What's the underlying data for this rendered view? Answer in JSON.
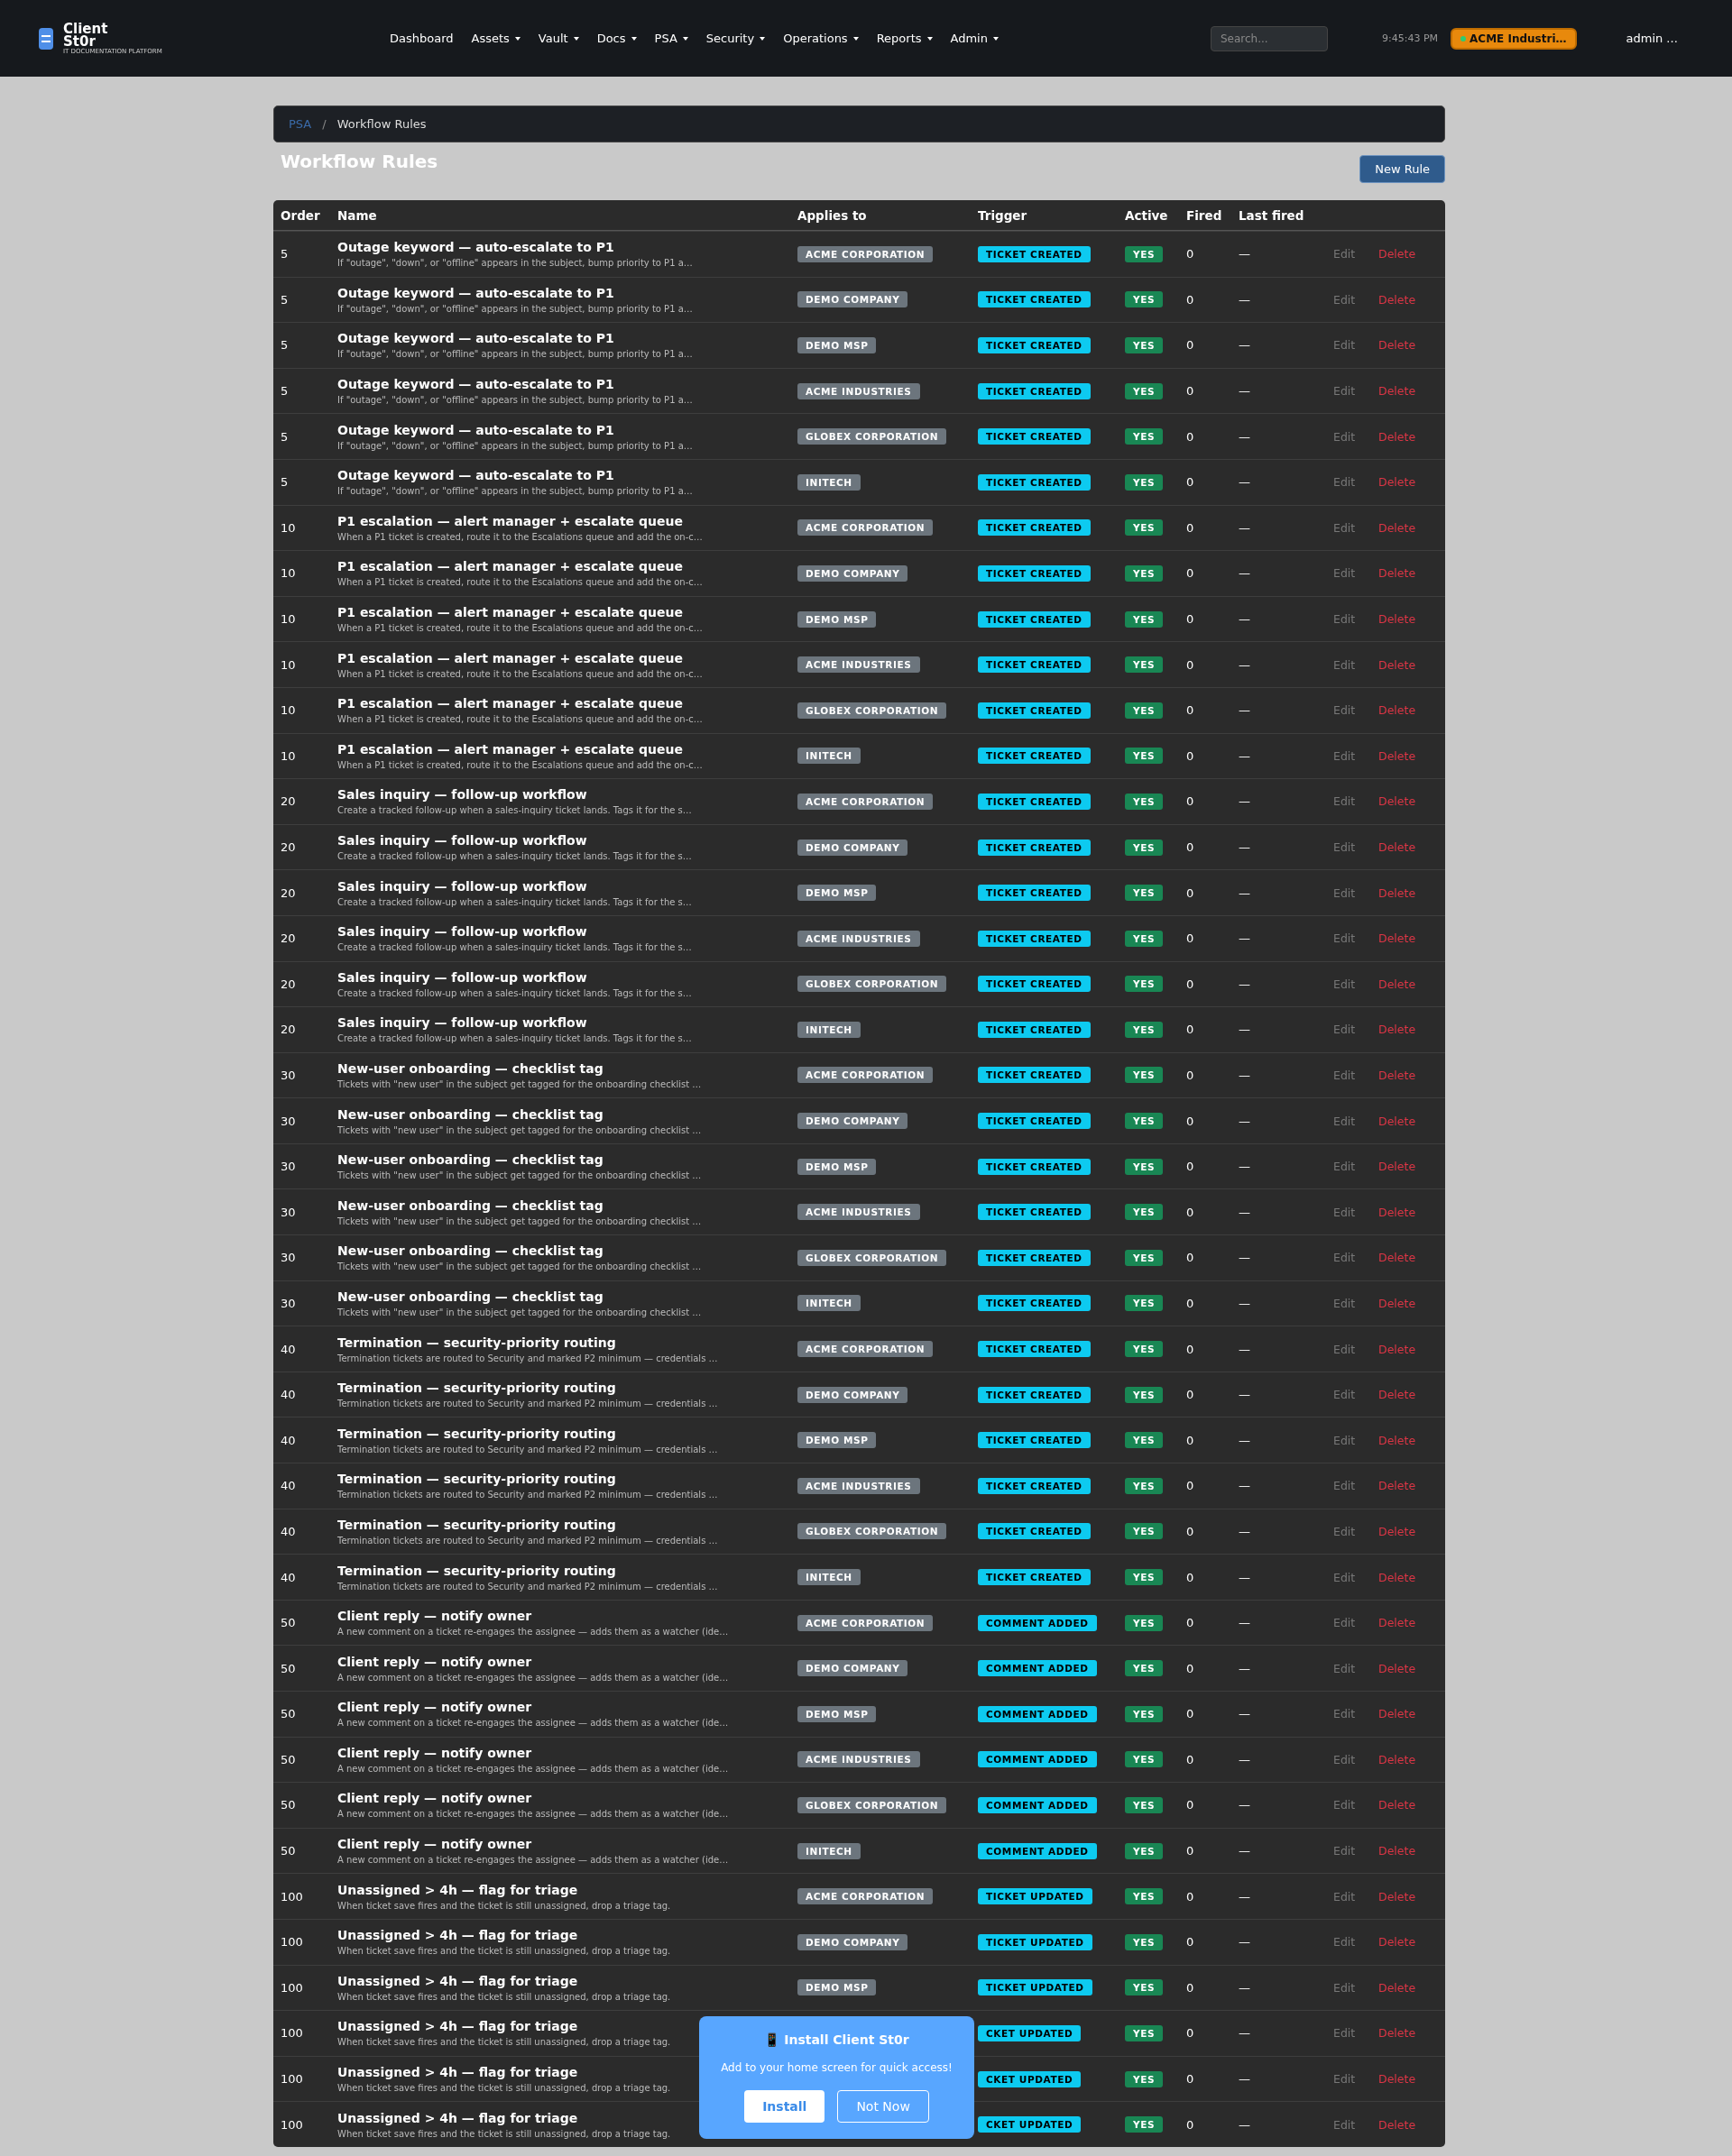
{
  "navbar": {
    "logo_title": "Client St0r",
    "logo_subtitle": "IT DOCUMENTATION PLATFORM",
    "menu": [
      {
        "label": "Dashboard",
        "dropdown": false
      },
      {
        "label": "Assets",
        "dropdown": true
      },
      {
        "label": "Vault",
        "dropdown": true
      },
      {
        "label": "Docs",
        "dropdown": true
      },
      {
        "label": "PSA",
        "dropdown": true
      },
      {
        "label": "Security",
        "dropdown": true
      },
      {
        "label": "Operations",
        "dropdown": true
      },
      {
        "label": "Reports",
        "dropdown": true
      },
      {
        "label": "Admin",
        "dropdown": true
      }
    ],
    "search": {
      "placeholder": "Search..."
    },
    "time": "9:45:43 PM",
    "org": "ACME Industri…",
    "user": "admin ..."
  },
  "breadcrumb_separator": "/",
  "breadcrumb": [
    {
      "label": "PSA",
      "link": true
    },
    {
      "label": "Workflow Rules",
      "link": false
    }
  ],
  "page_title": "Workflow Rules",
  "new_button": "New Rule",
  "table": {
    "columns": [
      "Order",
      "Name",
      "Applies to",
      "Trigger",
      "Active",
      "Fired",
      "Last fired"
    ],
    "rows": [
      {
        "order": "5",
        "name": "Outage keyword — auto-escalate to P1",
        "desc": "If \"outage\", \"down\", or \"offline\" appears in the subject, bump priority to P1 a…",
        "client": "ACME CORPORATION",
        "trigger": "TICKET CREATED",
        "active": "YES",
        "fired": "0",
        "last": "—",
        "edit": "Edit",
        "del": "Delete"
      },
      {
        "order": "5",
        "name": "Outage keyword — auto-escalate to P1",
        "desc": "If \"outage\", \"down\", or \"offline\" appears in the subject, bump priority to P1 a…",
        "client": "DEMO COMPANY",
        "trigger": "TICKET CREATED",
        "active": "YES",
        "fired": "0",
        "last": "—",
        "edit": "Edit",
        "del": "Delete"
      },
      {
        "order": "5",
        "name": "Outage keyword — auto-escalate to P1",
        "desc": "If \"outage\", \"down\", or \"offline\" appears in the subject, bump priority to P1 a…",
        "client": "DEMO MSP",
        "trigger": "TICKET CREATED",
        "active": "YES",
        "fired": "0",
        "last": "—",
        "edit": "Edit",
        "del": "Delete"
      },
      {
        "order": "5",
        "name": "Outage keyword — auto-escalate to P1",
        "desc": "If \"outage\", \"down\", or \"offline\" appears in the subject, bump priority to P1 a…",
        "client": "ACME INDUSTRIES",
        "trigger": "TICKET CREATED",
        "active": "YES",
        "fired": "0",
        "last": "—",
        "edit": "Edit",
        "del": "Delete"
      },
      {
        "order": "5",
        "name": "Outage keyword — auto-escalate to P1",
        "desc": "If \"outage\", \"down\", or \"offline\" appears in the subject, bump priority to P1 a…",
        "client": "GLOBEX CORPORATION",
        "trigger": "TICKET CREATED",
        "active": "YES",
        "fired": "0",
        "last": "—",
        "edit": "Edit",
        "del": "Delete"
      },
      {
        "order": "5",
        "name": "Outage keyword — auto-escalate to P1",
        "desc": "If \"outage\", \"down\", or \"offline\" appears in the subject, bump priority to P1 a…",
        "client": "INITECH",
        "trigger": "TICKET CREATED",
        "active": "YES",
        "fired": "0",
        "last": "—",
        "edit": "Edit",
        "del": "Delete"
      },
      {
        "order": "10",
        "name": "P1 escalation — alert manager + escalate queue",
        "desc": "When a P1 ticket is created, route it to the Escalations queue and add the on-c…",
        "client": "ACME CORPORATION",
        "trigger": "TICKET CREATED",
        "active": "YES",
        "fired": "0",
        "last": "—",
        "edit": "Edit",
        "del": "Delete"
      },
      {
        "order": "10",
        "name": "P1 escalation — alert manager + escalate queue",
        "desc": "When a P1 ticket is created, route it to the Escalations queue and add the on-c…",
        "client": "DEMO COMPANY",
        "trigger": "TICKET CREATED",
        "active": "YES",
        "fired": "0",
        "last": "—",
        "edit": "Edit",
        "del": "Delete"
      },
      {
        "order": "10",
        "name": "P1 escalation — alert manager + escalate queue",
        "desc": "When a P1 ticket is created, route it to the Escalations queue and add the on-c…",
        "client": "DEMO MSP",
        "trigger": "TICKET CREATED",
        "active": "YES",
        "fired": "0",
        "last": "—",
        "edit": "Edit",
        "del": "Delete"
      },
      {
        "order": "10",
        "name": "P1 escalation — alert manager + escalate queue",
        "desc": "When a P1 ticket is created, route it to the Escalations queue and add the on-c…",
        "client": "ACME INDUSTRIES",
        "trigger": "TICKET CREATED",
        "active": "YES",
        "fired": "0",
        "last": "—",
        "edit": "Edit",
        "del": "Delete"
      },
      {
        "order": "10",
        "name": "P1 escalation — alert manager + escalate queue",
        "desc": "When a P1 ticket is created, route it to the Escalations queue and add the on-c…",
        "client": "GLOBEX CORPORATION",
        "trigger": "TICKET CREATED",
        "active": "YES",
        "fired": "0",
        "last": "—",
        "edit": "Edit",
        "del": "Delete"
      },
      {
        "order": "10",
        "name": "P1 escalation — alert manager + escalate queue",
        "desc": "When a P1 ticket is created, route it to the Escalations queue and add the on-c…",
        "client": "INITECH",
        "trigger": "TICKET CREATED",
        "active": "YES",
        "fired": "0",
        "last": "—",
        "edit": "Edit",
        "del": "Delete"
      },
      {
        "order": "20",
        "name": "Sales inquiry — follow-up workflow",
        "desc": "Create a tracked follow-up when a sales-inquiry ticket lands. Tags it for the s…",
        "client": "ACME CORPORATION",
        "trigger": "TICKET CREATED",
        "active": "YES",
        "fired": "0",
        "last": "—",
        "edit": "Edit",
        "del": "Delete"
      },
      {
        "order": "20",
        "name": "Sales inquiry — follow-up workflow",
        "desc": "Create a tracked follow-up when a sales-inquiry ticket lands. Tags it for the s…",
        "client": "DEMO COMPANY",
        "trigger": "TICKET CREATED",
        "active": "YES",
        "fired": "0",
        "last": "—",
        "edit": "Edit",
        "del": "Delete"
      },
      {
        "order": "20",
        "name": "Sales inquiry — follow-up workflow",
        "desc": "Create a tracked follow-up when a sales-inquiry ticket lands. Tags it for the s…",
        "client": "DEMO MSP",
        "trigger": "TICKET CREATED",
        "active": "YES",
        "fired": "0",
        "last": "—",
        "edit": "Edit",
        "del": "Delete"
      },
      {
        "order": "20",
        "name": "Sales inquiry — follow-up workflow",
        "desc": "Create a tracked follow-up when a sales-inquiry ticket lands. Tags it for the s…",
        "client": "ACME INDUSTRIES",
        "trigger": "TICKET CREATED",
        "active": "YES",
        "fired": "0",
        "last": "—",
        "edit": "Edit",
        "del": "Delete"
      },
      {
        "order": "20",
        "name": "Sales inquiry — follow-up workflow",
        "desc": "Create a tracked follow-up when a sales-inquiry ticket lands. Tags it for the s…",
        "client": "GLOBEX CORPORATION",
        "trigger": "TICKET CREATED",
        "active": "YES",
        "fired": "0",
        "last": "—",
        "edit": "Edit",
        "del": "Delete"
      },
      {
        "order": "20",
        "name": "Sales inquiry — follow-up workflow",
        "desc": "Create a tracked follow-up when a sales-inquiry ticket lands. Tags it for the s…",
        "client": "INITECH",
        "trigger": "TICKET CREATED",
        "active": "YES",
        "fired": "0",
        "last": "—",
        "edit": "Edit",
        "del": "Delete"
      },
      {
        "order": "30",
        "name": "New-user onboarding — checklist tag",
        "desc": "Tickets with \"new user\" in the subject get tagged for the onboarding checklist …",
        "client": "ACME CORPORATION",
        "trigger": "TICKET CREATED",
        "active": "YES",
        "fired": "0",
        "last": "—",
        "edit": "Edit",
        "del": "Delete"
      },
      {
        "order": "30",
        "name": "New-user onboarding — checklist tag",
        "desc": "Tickets with \"new user\" in the subject get tagged for the onboarding checklist …",
        "client": "DEMO COMPANY",
        "trigger": "TICKET CREATED",
        "active": "YES",
        "fired": "0",
        "last": "—",
        "edit": "Edit",
        "del": "Delete"
      },
      {
        "order": "30",
        "name": "New-user onboarding — checklist tag",
        "desc": "Tickets with \"new user\" in the subject get tagged for the onboarding checklist …",
        "client": "DEMO MSP",
        "trigger": "TICKET CREATED",
        "active": "YES",
        "fired": "0",
        "last": "—",
        "edit": "Edit",
        "del": "Delete"
      },
      {
        "order": "30",
        "name": "New-user onboarding — checklist tag",
        "desc": "Tickets with \"new user\" in the subject get tagged for the onboarding checklist …",
        "client": "ACME INDUSTRIES",
        "trigger": "TICKET CREATED",
        "active": "YES",
        "fired": "0",
        "last": "—",
        "edit": "Edit",
        "del": "Delete"
      },
      {
        "order": "30",
        "name": "New-user onboarding — checklist tag",
        "desc": "Tickets with \"new user\" in the subject get tagged for the onboarding checklist …",
        "client": "GLOBEX CORPORATION",
        "trigger": "TICKET CREATED",
        "active": "YES",
        "fired": "0",
        "last": "—",
        "edit": "Edit",
        "del": "Delete"
      },
      {
        "order": "30",
        "name": "New-user onboarding — checklist tag",
        "desc": "Tickets with \"new user\" in the subject get tagged for the onboarding checklist …",
        "client": "INITECH",
        "trigger": "TICKET CREATED",
        "active": "YES",
        "fired": "0",
        "last": "—",
        "edit": "Edit",
        "del": "Delete"
      },
      {
        "order": "40",
        "name": "Termination — security-priority routing",
        "desc": "Termination tickets are routed to Security and marked P2 minimum — credentials …",
        "client": "ACME CORPORATION",
        "trigger": "TICKET CREATED",
        "active": "YES",
        "fired": "0",
        "last": "—",
        "edit": "Edit",
        "del": "Delete"
      },
      {
        "order": "40",
        "name": "Termination — security-priority routing",
        "desc": "Termination tickets are routed to Security and marked P2 minimum — credentials …",
        "client": "DEMO COMPANY",
        "trigger": "TICKET CREATED",
        "active": "YES",
        "fired": "0",
        "last": "—",
        "edit": "Edit",
        "del": "Delete"
      },
      {
        "order": "40",
        "name": "Termination — security-priority routing",
        "desc": "Termination tickets are routed to Security and marked P2 minimum — credentials …",
        "client": "DEMO MSP",
        "trigger": "TICKET CREATED",
        "active": "YES",
        "fired": "0",
        "last": "—",
        "edit": "Edit",
        "del": "Delete"
      },
      {
        "order": "40",
        "name": "Termination — security-priority routing",
        "desc": "Termination tickets are routed to Security and marked P2 minimum — credentials …",
        "client": "ACME INDUSTRIES",
        "trigger": "TICKET CREATED",
        "active": "YES",
        "fired": "0",
        "last": "—",
        "edit": "Edit",
        "del": "Delete"
      },
      {
        "order": "40",
        "name": "Termination — security-priority routing",
        "desc": "Termination tickets are routed to Security and marked P2 minimum — credentials …",
        "client": "GLOBEX CORPORATION",
        "trigger": "TICKET CREATED",
        "active": "YES",
        "fired": "0",
        "last": "—",
        "edit": "Edit",
        "del": "Delete"
      },
      {
        "order": "40",
        "name": "Termination — security-priority routing",
        "desc": "Termination tickets are routed to Security and marked P2 minimum — credentials …",
        "client": "INITECH",
        "trigger": "TICKET CREATED",
        "active": "YES",
        "fired": "0",
        "last": "—",
        "edit": "Edit",
        "del": "Delete"
      },
      {
        "order": "50",
        "name": "Client reply — notify owner",
        "desc": "A new comment on a ticket re-engages the assignee — adds them as a watcher (ide…",
        "client": "ACME CORPORATION",
        "trigger": "COMMENT ADDED",
        "active": "YES",
        "fired": "0",
        "last": "—",
        "edit": "Edit",
        "del": "Delete"
      },
      {
        "order": "50",
        "name": "Client reply — notify owner",
        "desc": "A new comment on a ticket re-engages the assignee — adds them as a watcher (ide…",
        "client": "DEMO COMPANY",
        "trigger": "COMMENT ADDED",
        "active": "YES",
        "fired": "0",
        "last": "—",
        "edit": "Edit",
        "del": "Delete"
      },
      {
        "order": "50",
        "name": "Client reply — notify owner",
        "desc": "A new comment on a ticket re-engages the assignee — adds them as a watcher (ide…",
        "client": "DEMO MSP",
        "trigger": "COMMENT ADDED",
        "active": "YES",
        "fired": "0",
        "last": "—",
        "edit": "Edit",
        "del": "Delete"
      },
      {
        "order": "50",
        "name": "Client reply — notify owner",
        "desc": "A new comment on a ticket re-engages the assignee — adds them as a watcher (ide…",
        "client": "ACME INDUSTRIES",
        "trigger": "COMMENT ADDED",
        "active": "YES",
        "fired": "0",
        "last": "—",
        "edit": "Edit",
        "del": "Delete"
      },
      {
        "order": "50",
        "name": "Client reply — notify owner",
        "desc": "A new comment on a ticket re-engages the assignee — adds them as a watcher (ide…",
        "client": "GLOBEX CORPORATION",
        "trigger": "COMMENT ADDED",
        "active": "YES",
        "fired": "0",
        "last": "—",
        "edit": "Edit",
        "del": "Delete"
      },
      {
        "order": "50",
        "name": "Client reply — notify owner",
        "desc": "A new comment on a ticket re-engages the assignee — adds them as a watcher (ide…",
        "client": "INITECH",
        "trigger": "COMMENT ADDED",
        "active": "YES",
        "fired": "0",
        "last": "—",
        "edit": "Edit",
        "del": "Delete"
      },
      {
        "order": "100",
        "name": "Unassigned > 4h — flag for triage",
        "desc": "When ticket save fires and the ticket is still unassigned, drop a triage tag.",
        "client": "ACME CORPORATION",
        "trigger": "TICKET UPDATED",
        "active": "YES",
        "fired": "0",
        "last": "—",
        "edit": "Edit",
        "del": "Delete"
      },
      {
        "order": "100",
        "name": "Unassigned > 4h — flag for triage",
        "desc": "When ticket save fires and the ticket is still unassigned, drop a triage tag.",
        "client": "DEMO COMPANY",
        "trigger": "TICKET UPDATED",
        "active": "YES",
        "fired": "0",
        "last": "—",
        "edit": "Edit",
        "del": "Delete"
      },
      {
        "order": "100",
        "name": "Unassigned > 4h — flag for triage",
        "desc": "When ticket save fires and the ticket is still unassigned, drop a triage tag.",
        "client": "DEMO MSP",
        "trigger": "TICKET UPDATED",
        "active": "YES",
        "fired": "0",
        "last": "—",
        "edit": "Edit",
        "del": "Delete"
      },
      {
        "order": "100",
        "name": "Unassigned > 4h — flag for triage",
        "desc": "When ticket save fires and the ticket is still unassigned, drop a triage tag.",
        "trigger": "CKET UPDATED",
        "active": "YES",
        "fired": "0",
        "last": "—",
        "edit": "Edit",
        "del": "Delete"
      },
      {
        "order": "100",
        "name": "Unassigned > 4h — flag for triage",
        "desc": "When ticket save fires and the ticket is still unassigned, drop a triage tag.",
        "trigger": "CKET UPDATED",
        "active": "YES",
        "fired": "0",
        "last": "—",
        "edit": "Edit",
        "del": "Delete"
      },
      {
        "order": "100",
        "name": "Unassigned > 4h — flag for triage",
        "desc": "When ticket save fires and the ticket is still unassigned, drop a triage tag.",
        "trigger": "CKET UPDATED",
        "active": "YES",
        "fired": "0",
        "last": "—",
        "edit": "Edit",
        "del": "Delete"
      }
    ]
  },
  "install_prompt": {
    "title": "📱 Install Client St0r",
    "text": "Add to your home screen for quick access!",
    "install": "Install",
    "dismiss": "Not Now"
  }
}
